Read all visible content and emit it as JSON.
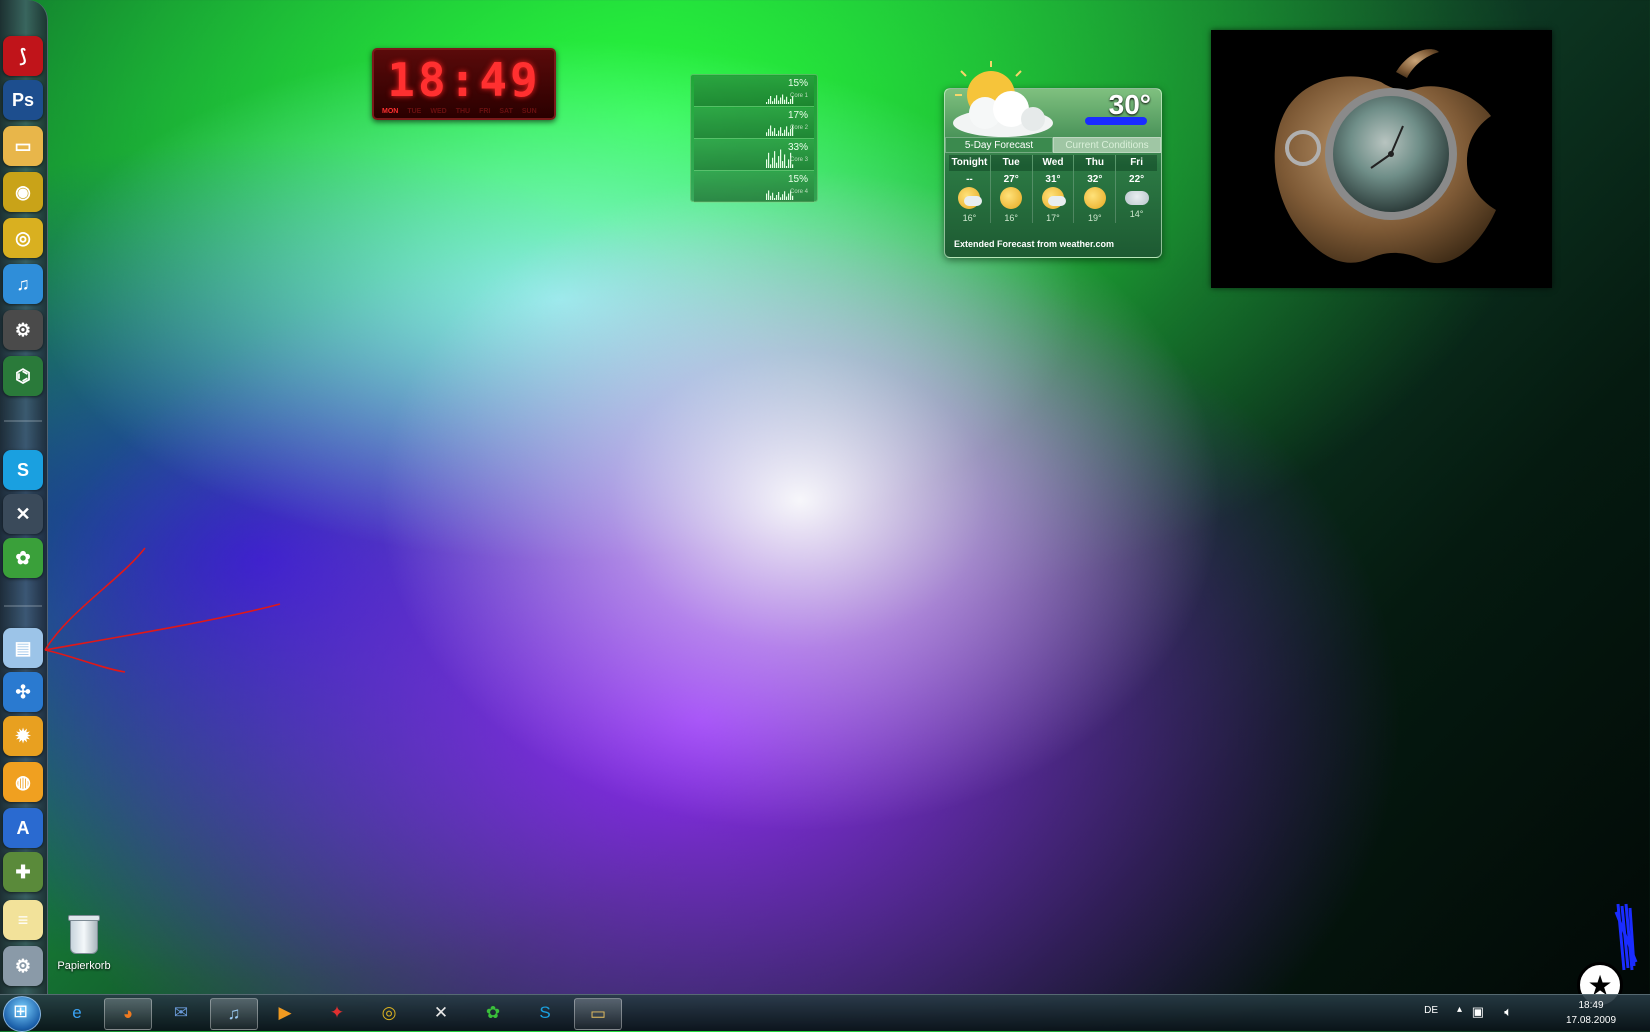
{
  "clock": {
    "time": "18:49",
    "days": [
      "MON",
      "TUE",
      "WED",
      "THU",
      "FRI",
      "SAT",
      "SUN"
    ],
    "active_day": 0
  },
  "cpu_meter": {
    "cores": [
      {
        "percent": "15%",
        "label": "Core 1"
      },
      {
        "percent": "17%",
        "label": "Core 2"
      },
      {
        "percent": "33%",
        "label": "Core 3"
      },
      {
        "percent": "15%",
        "label": "Core 4"
      }
    ]
  },
  "weather": {
    "current_temp": "30°",
    "tab_forecast": "5-Day Forecast",
    "tab_current": "Current Conditions",
    "days": [
      {
        "name": "Tonight",
        "high": "--",
        "low": "16°",
        "icon": "partly-cloudy-icon"
      },
      {
        "name": "Tue",
        "high": "27°",
        "low": "16°",
        "icon": "sunny-icon"
      },
      {
        "name": "Wed",
        "high": "31°",
        "low": "17°",
        "icon": "partly-cloudy-icon"
      },
      {
        "name": "Thu",
        "high": "32°",
        "low": "19°",
        "icon": "sunny-icon"
      },
      {
        "name": "Fri",
        "high": "22°",
        "low": "14°",
        "icon": "rain-icon"
      }
    ],
    "footer": "Extended Forecast from weather.com"
  },
  "desktop": {
    "recycle_bin_label": "Papierkorb"
  },
  "dock": {
    "items": [
      {
        "name": "acrobat-icon",
        "glyph": "⟆",
        "color": "#c0141a"
      },
      {
        "name": "photoshop-icon",
        "glyph": "Ps",
        "color": "#1d4e8e"
      },
      {
        "name": "folder-icon",
        "glyph": "▭",
        "color": "#e8b64a"
      },
      {
        "name": "disc-burner-icon",
        "glyph": "◉",
        "color": "#c9a318"
      },
      {
        "name": "dvd-player-icon",
        "glyph": "◎",
        "color": "#d9b020"
      },
      {
        "name": "itunes-icon",
        "glyph": "♫",
        "color": "#2f8ed9"
      },
      {
        "name": "yahoo-widgets-icon",
        "glyph": "⚙",
        "color": "#4a4a4a"
      },
      {
        "name": "network-icon",
        "glyph": "⌬",
        "color": "#2a7a3a"
      },
      {
        "name": "skype-icon",
        "glyph": "S",
        "color": "#1aa0e0"
      },
      {
        "name": "app-x-icon",
        "glyph": "✕",
        "color": "#3a4a5a"
      },
      {
        "name": "icq-icon",
        "glyph": "✿",
        "color": "#3aa03a"
      },
      {
        "name": "clapper-icon",
        "glyph": "▤",
        "color": "#9cc4e8"
      },
      {
        "name": "safari-icon",
        "glyph": "✣",
        "color": "#2a7ad0"
      },
      {
        "name": "iphoto-icon",
        "glyph": "✹",
        "color": "#e8a020"
      },
      {
        "name": "ipod-icon",
        "glyph": "◍",
        "color": "#f0a020"
      },
      {
        "name": "app-store-icon",
        "glyph": "A",
        "color": "#2a6ad0"
      },
      {
        "name": "game-controller-icon",
        "glyph": "✚",
        "color": "#5a8a3a"
      },
      {
        "name": "notes-icon",
        "glyph": "≡",
        "color": "#f2e29a"
      },
      {
        "name": "system-preferences-icon",
        "glyph": "⚙",
        "color": "#8a9aa8"
      }
    ]
  },
  "taskbar": {
    "buttons": [
      {
        "name": "internet-explorer-icon",
        "glyph": "e",
        "color": "#3aa0f0",
        "pinned": false
      },
      {
        "name": "firefox-icon",
        "glyph": "◕",
        "color": "#f07a20",
        "pinned": true
      },
      {
        "name": "thunderbird-icon",
        "glyph": "✉",
        "color": "#6a9ad8",
        "pinned": false
      },
      {
        "name": "itunes-icon",
        "glyph": "♫",
        "color": "#9ac8f0",
        "pinned": true
      },
      {
        "name": "media-player-icon",
        "glyph": "▶",
        "color": "#f09a20",
        "pinned": false
      },
      {
        "name": "adobe-app-icon",
        "glyph": "✦",
        "color": "#e03030",
        "pinned": false
      },
      {
        "name": "dvd-player-icon",
        "glyph": "◎",
        "color": "#d9b020",
        "pinned": false
      },
      {
        "name": "app-x-icon",
        "glyph": "✕",
        "color": "#e8e8e8",
        "pinned": false
      },
      {
        "name": "icq-icon",
        "glyph": "✿",
        "color": "#3ac03a",
        "pinned": false
      },
      {
        "name": "skype-icon",
        "glyph": "S",
        "color": "#1aa0e0",
        "pinned": false
      },
      {
        "name": "explorer-icon",
        "glyph": "▭",
        "color": "#e8c060",
        "pinned": true
      }
    ],
    "language": "DE",
    "time": "18:49",
    "date": "17.08.2009"
  }
}
